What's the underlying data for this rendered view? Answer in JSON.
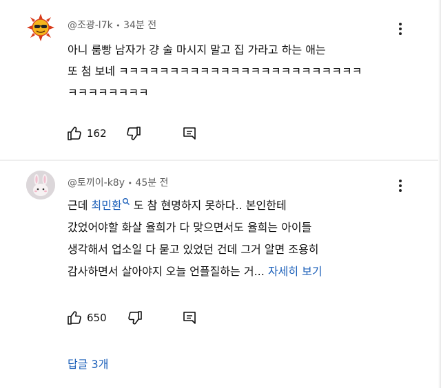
{
  "comments": [
    {
      "author": "@조광-l7k",
      "sep": "•",
      "time": "34분 전",
      "lines": [
        "아니 룸빵 남자가 걍 술 마시지 말고 집 가라고 하는 애는",
        "또 첨 보네 ㅋㅋㅋㅋㅋㅋㅋㅋㅋㅋㅋㅋㅋㅋㅋㅋㅋㅋㅋㅋㅋㅋㅋㅋ",
        "ㅋㅋㅋㅋㅋㅋㅋㅋ"
      ],
      "likes": "162",
      "avatar_icon": "sun-with-sunglasses-icon"
    },
    {
      "author": "@토끼이-k8y",
      "sep": "•",
      "time": "45분 전",
      "line1_prefix": "근데 ",
      "mention": "최민환",
      "line1_suffix": " 도 참 현명하지 못하다.. 본인한테",
      "lines": [
        "갔었어야할 화살 율희가 다 맞으면서도 율희는 아이들",
        "생각해서 업소일 다 묻고 있었던 건데 그거 알면 조용히"
      ],
      "line5_prefix": "감사하면서 살아야지 오늘 언플질하는 거...",
      "read_more": "자세히 보기",
      "likes": "650",
      "avatar_icon": "rabbit-avatar-icon"
    }
  ],
  "replies_label": "답글 3개",
  "colors": {
    "link": "#1b5fb9",
    "meta": "#606060",
    "text": "#0f0f0f"
  }
}
